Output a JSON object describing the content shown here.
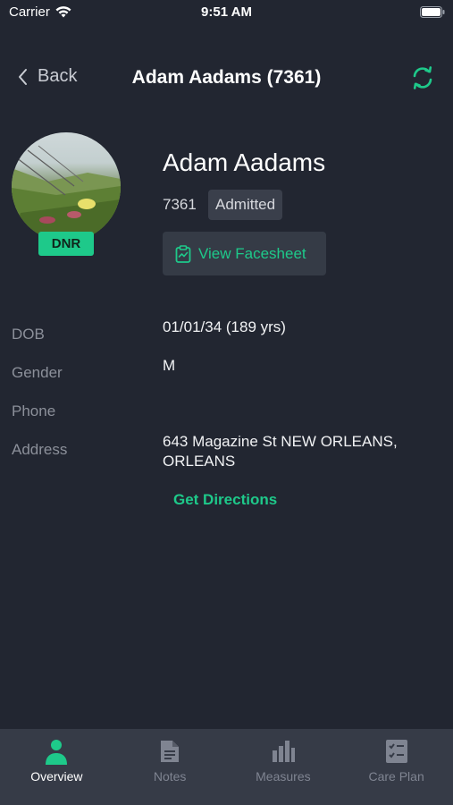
{
  "status_bar": {
    "carrier": "Carrier",
    "time": "9:51 AM"
  },
  "nav": {
    "back_label": "Back",
    "title": "Adam Aadams (7361)"
  },
  "profile": {
    "badge": "DNR",
    "name": "Adam Aadams",
    "id": "7361",
    "status": "Admitted",
    "facesheet_label": "View Facesheet"
  },
  "details": {
    "dob_label": "DOB",
    "dob_value": "01/01/34 (189 yrs)",
    "gender_label": "Gender",
    "gender_value": "M",
    "phone_label": "Phone",
    "phone_value": "",
    "address_label": "Address",
    "address_line1": "643 Magazine St NEW ORLEANS,",
    "address_line2": "ORLEANS",
    "directions_label": "Get Directions"
  },
  "tabs": [
    {
      "label": "Overview",
      "icon": "person-icon",
      "active": true
    },
    {
      "label": "Notes",
      "icon": "document-icon",
      "active": false
    },
    {
      "label": "Measures",
      "icon": "bar-chart-icon",
      "active": false
    },
    {
      "label": "Care Plan",
      "icon": "checklist-icon",
      "active": false
    }
  ],
  "colors": {
    "background": "#222631",
    "accent": "#1ec98a",
    "tab_bar": "#363b47"
  }
}
